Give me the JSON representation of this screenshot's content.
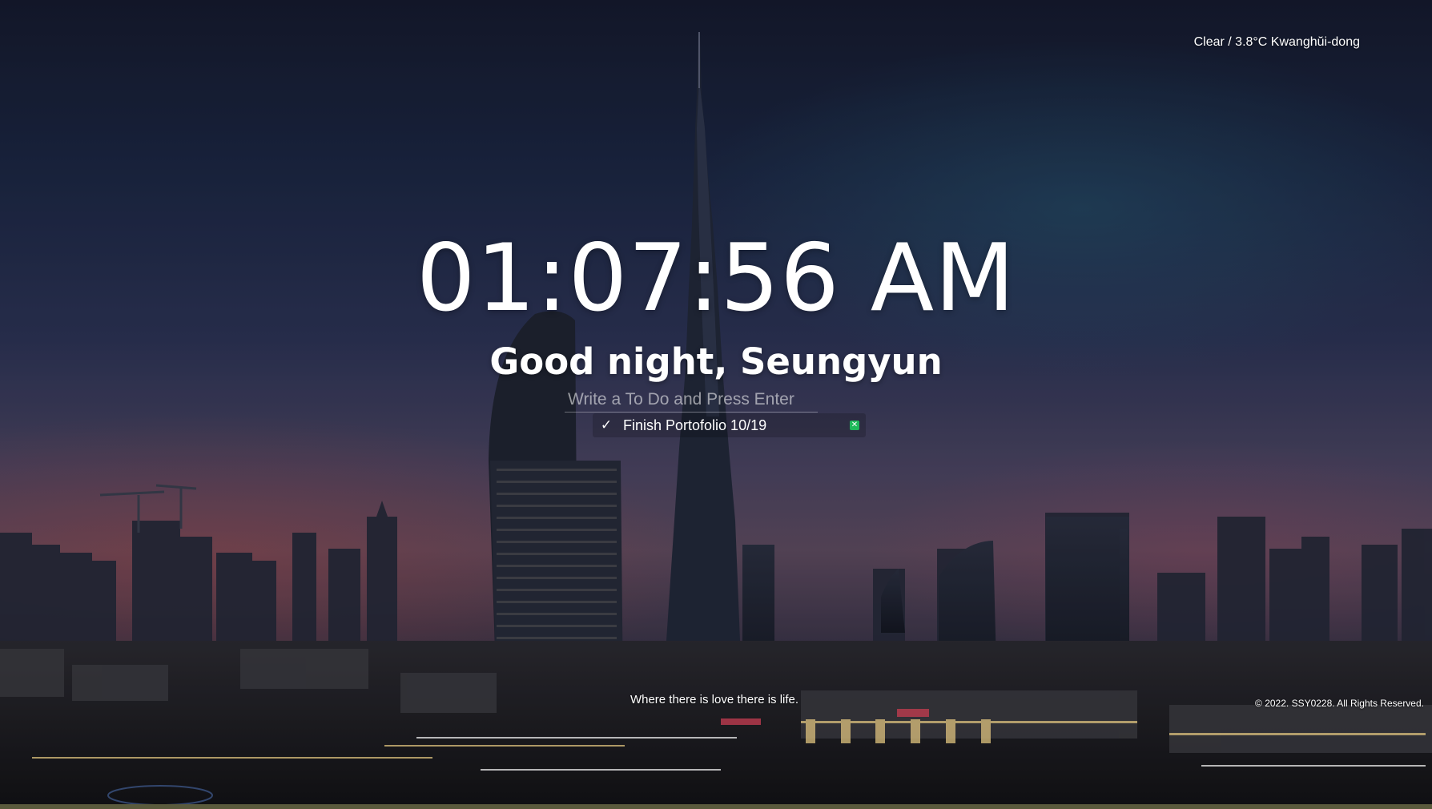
{
  "weather": {
    "text": "Clear / 3.8°C Kwanghŭi-dong"
  },
  "clock": {
    "time": "01:07:56 AM"
  },
  "greeting": {
    "text": "Good night, Seungyun"
  },
  "todo": {
    "placeholder": "Write a To Do and Press Enter",
    "value": "",
    "items": [
      {
        "text": "Finish Portofolio 10/19",
        "check_icon": "checkmark-icon",
        "delete_icon": "close-icon"
      }
    ]
  },
  "quote": {
    "text": "Where there is love there is life."
  },
  "footer": {
    "copyright": "© 2022. SSY0228. All Rights Reserved."
  },
  "colors": {
    "delete_button": "#1fb85a",
    "text": "#ffffff"
  },
  "background": {
    "icon": "city-skyline-image"
  }
}
